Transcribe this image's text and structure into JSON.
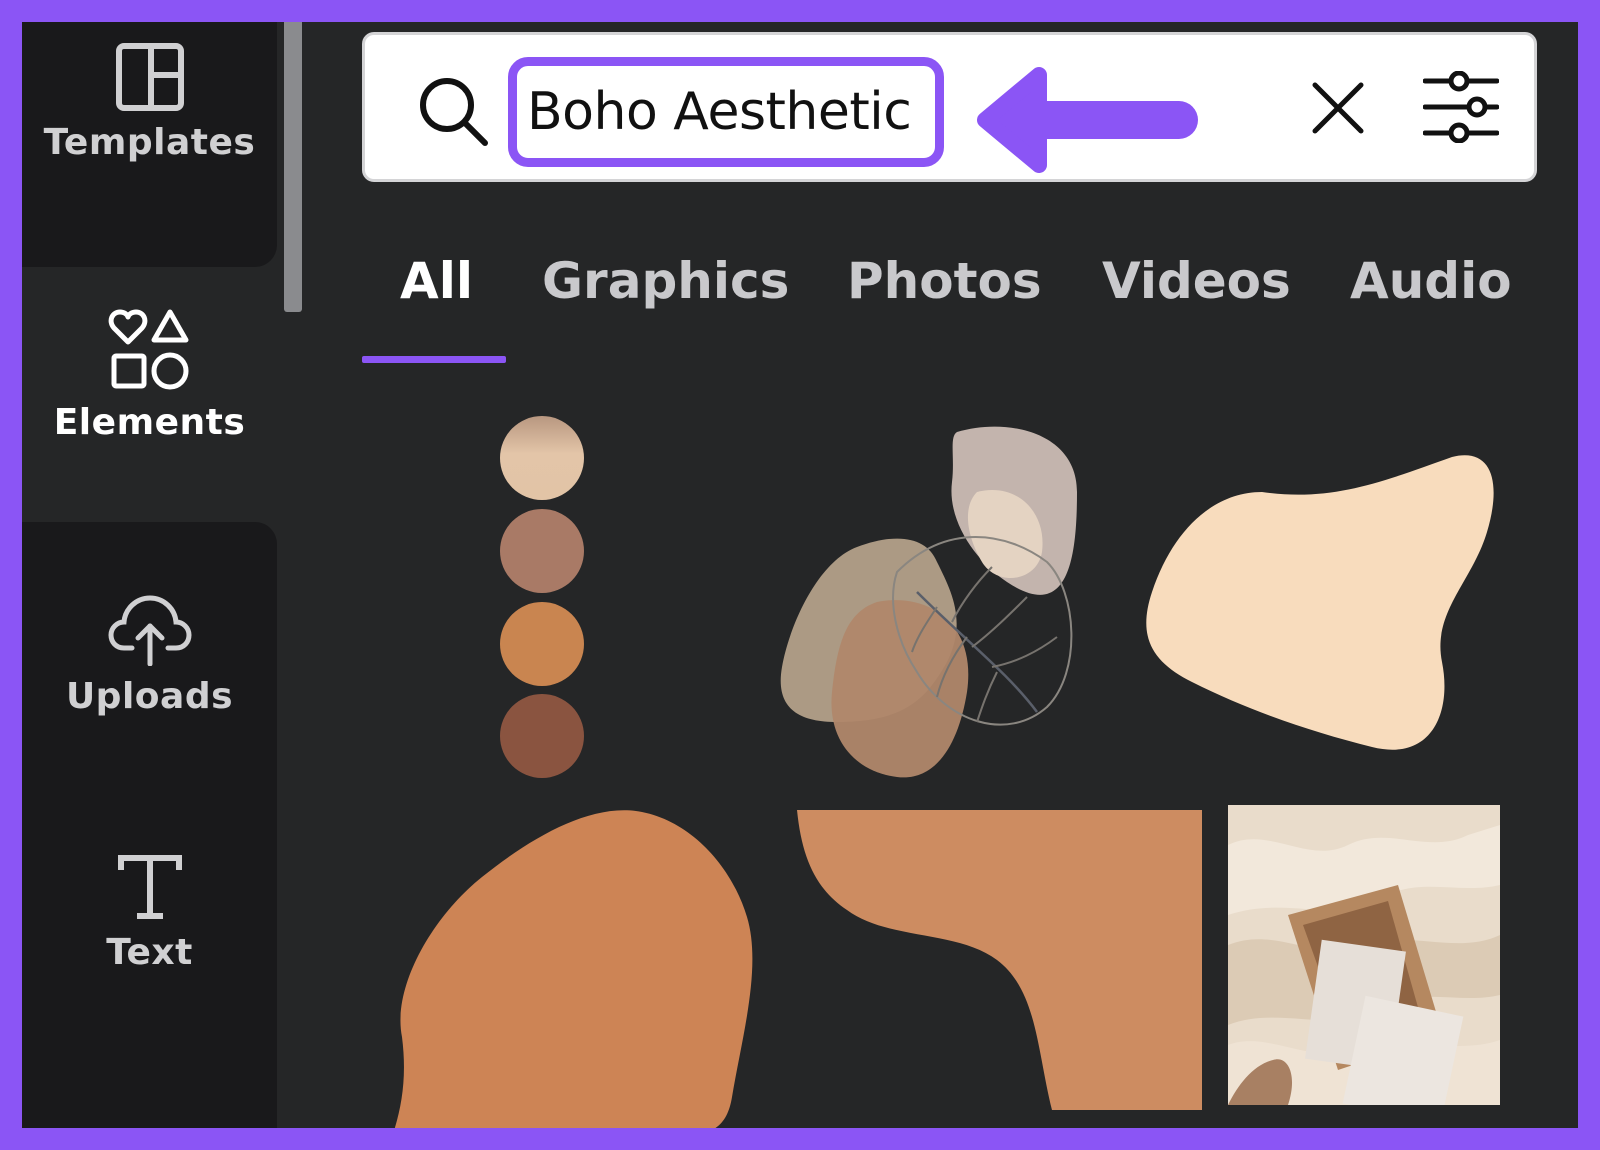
{
  "sidebar": {
    "items": [
      {
        "label": "Templates",
        "icon": "templates-layout-icon"
      },
      {
        "label": "Elements",
        "icon": "elements-shapes-icon",
        "active": true
      },
      {
        "label": "Uploads",
        "icon": "cloud-upload-icon"
      },
      {
        "label": "Text",
        "icon": "text-t-icon"
      }
    ]
  },
  "search": {
    "value": "Boho Aesthetic",
    "clear_icon": "close-icon",
    "filter_icon": "sliders-filter-icon"
  },
  "tabs": [
    {
      "label": "All",
      "active": true
    },
    {
      "label": "Graphics"
    },
    {
      "label": "Photos"
    },
    {
      "label": "Videos"
    },
    {
      "label": "Audio"
    }
  ],
  "results": [
    {
      "name": "boho-color-palette-dots",
      "colors": [
        "#dfc2a6",
        "#a97a66",
        "#c98550",
        "#8a5440"
      ]
    },
    {
      "name": "boho-leaf-blobs"
    },
    {
      "name": "cream-blob",
      "colors": [
        "#f8dcbd"
      ]
    },
    {
      "name": "terracotta-blob",
      "colors": [
        "#cd8455"
      ]
    },
    {
      "name": "terracotta-corner-shape",
      "colors": [
        "#cd8c61"
      ]
    },
    {
      "name": "beige-fabric-photo"
    }
  ],
  "colors": {
    "accent": "#8b55f5",
    "panel": "#252627",
    "sidebar_tile": "#19191b"
  }
}
